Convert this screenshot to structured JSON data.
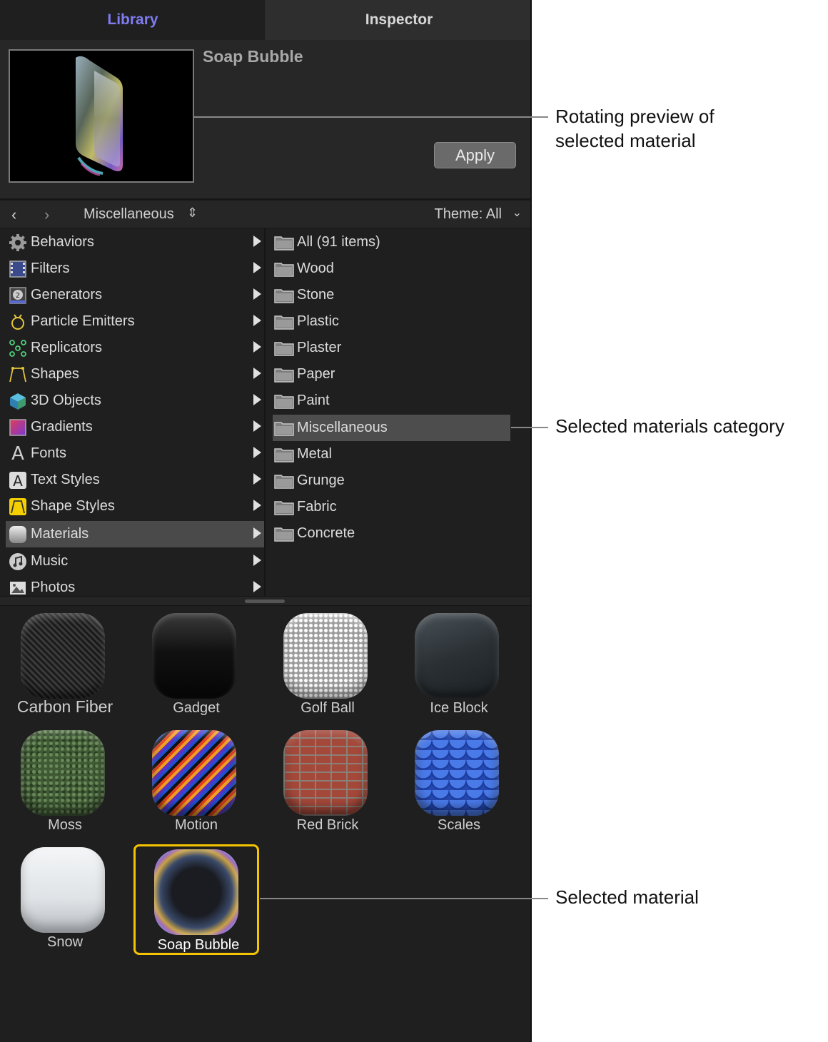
{
  "tabs": {
    "library": "Library",
    "inspector": "Inspector"
  },
  "preview": {
    "name": "Soap Bubble",
    "apply_label": "Apply"
  },
  "nav": {
    "back": "‹",
    "forward": "›",
    "category": "Miscellaneous",
    "theme": "Theme: All"
  },
  "sidebar": {
    "items": [
      {
        "label": "Behaviors",
        "icon": "gear-icon"
      },
      {
        "label": "Filters",
        "icon": "film-icon"
      },
      {
        "label": "Generators",
        "icon": "generator-icon"
      },
      {
        "label": "Particle Emitters",
        "icon": "emitter-icon"
      },
      {
        "label": "Replicators",
        "icon": "replicator-icon"
      },
      {
        "label": "Shapes",
        "icon": "shape-icon"
      },
      {
        "label": "3D Objects",
        "icon": "cube-icon"
      },
      {
        "label": "Gradients",
        "icon": "gradient-icon"
      },
      {
        "label": "Fonts",
        "icon": "font-icon"
      },
      {
        "label": "Text Styles",
        "icon": "text-style-icon"
      },
      {
        "label": "Shape Styles",
        "icon": "shape-style-icon"
      },
      {
        "label": "Materials",
        "icon": "material-icon"
      },
      {
        "label": "Music",
        "icon": "music-icon"
      },
      {
        "label": "Photos",
        "icon": "photo-icon"
      }
    ]
  },
  "folders": {
    "items": [
      {
        "label": "All (91 items)"
      },
      {
        "label": "Wood"
      },
      {
        "label": "Stone"
      },
      {
        "label": "Plastic"
      },
      {
        "label": "Plaster"
      },
      {
        "label": "Paper"
      },
      {
        "label": "Paint"
      },
      {
        "label": "Miscellaneous"
      },
      {
        "label": "Metal"
      },
      {
        "label": "Grunge"
      },
      {
        "label": "Fabric"
      },
      {
        "label": "Concrete"
      }
    ]
  },
  "materials": {
    "items": [
      {
        "label": "Carbon Fiber"
      },
      {
        "label": "Gadget"
      },
      {
        "label": "Golf Ball"
      },
      {
        "label": "Ice Block"
      },
      {
        "label": "Moss"
      },
      {
        "label": "Motion"
      },
      {
        "label": "Red Brick"
      },
      {
        "label": "Scales"
      },
      {
        "label": "Snow"
      },
      {
        "label": "Soap Bubble"
      }
    ]
  },
  "callouts": {
    "preview_line1": "Rotating preview of",
    "preview_line2": "selected material",
    "category": "Selected materials category",
    "material": "Selected material"
  },
  "colors": {
    "accent_tab": "#7f7cf0",
    "selection_outline": "#f5c400"
  }
}
